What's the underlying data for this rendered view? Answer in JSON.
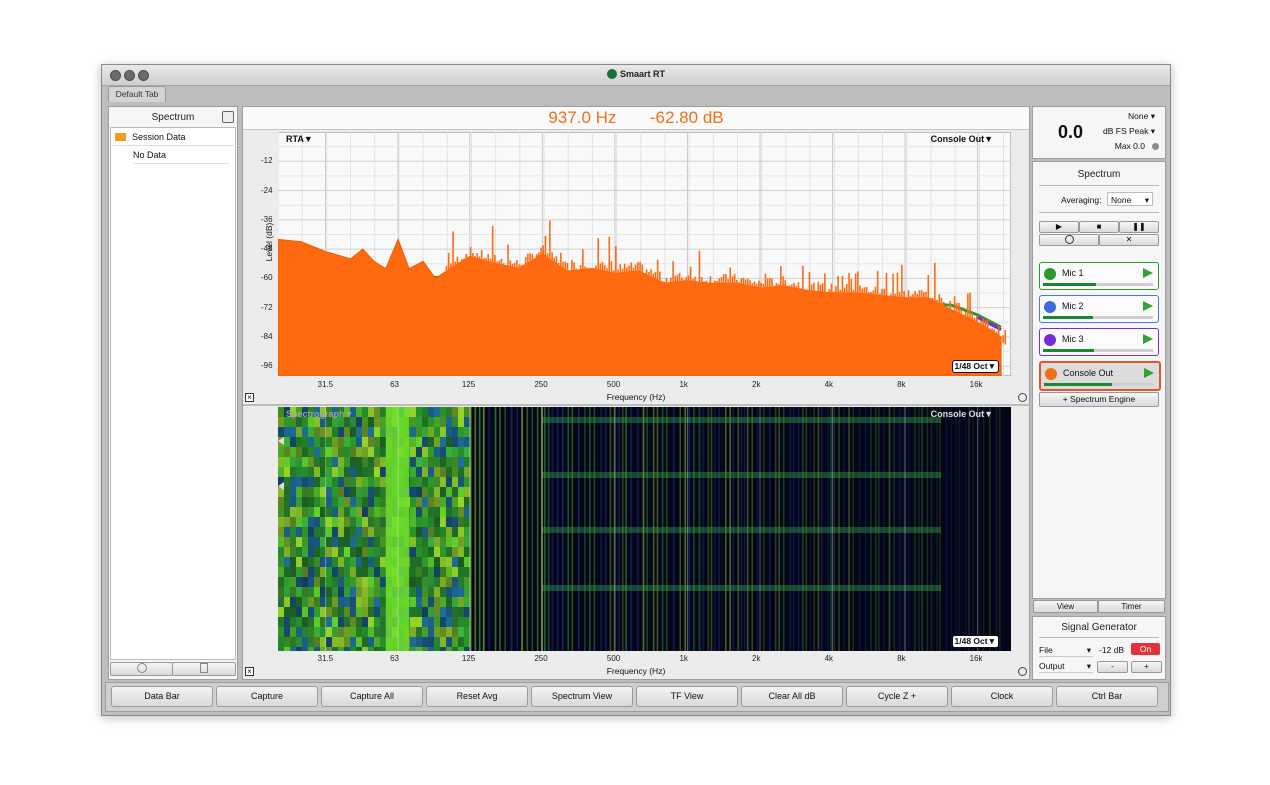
{
  "window": {
    "title": "Smaart RT",
    "tab": "Default Tab"
  },
  "left_panel": {
    "title": "Spectrum",
    "items": [
      {
        "label": "Session Data"
      },
      {
        "label": "No Data"
      }
    ]
  },
  "readout": {
    "frequency": "937.0 Hz",
    "level": "-62.80 dB"
  },
  "rta": {
    "mode_label": "RTA▼",
    "source_label": "Console Out▼",
    "resolution": "1/48 Oct▼",
    "y_axis_label": "Level (dB)",
    "x_axis_label": "Frequency (Hz)",
    "y_ticks": [
      "-12",
      "-24",
      "-36",
      "-48",
      "-60",
      "-72",
      "-84",
      "-96"
    ],
    "x_ticks": [
      "31.5",
      "63",
      "125",
      "250",
      "500",
      "1k",
      "2k",
      "4k",
      "8k",
      "16k"
    ]
  },
  "spectrograph": {
    "mode_label": "Spectrograph▼",
    "source_label": "Console Out▼",
    "resolution": "1/48 Oct▼",
    "x_axis_label": "Frequency (Hz)",
    "x_ticks": [
      "31.5",
      "63",
      "125",
      "250",
      "500",
      "1k",
      "2k",
      "4k",
      "8k",
      "16k"
    ]
  },
  "chart_data": {
    "type": "area",
    "title": "",
    "xlabel": "Frequency (Hz)",
    "ylabel": "Level (dB)",
    "x_scale": "log",
    "xlim": [
      20,
      22000
    ],
    "ylim": [
      -100,
      0
    ],
    "grid": true,
    "series": [
      {
        "name": "Console Out",
        "color": "#ff6a10",
        "x": [
          20,
          25,
          31.5,
          40,
          45,
          50,
          56,
          63,
          70,
          80,
          90,
          100,
          125,
          160,
          200,
          250,
          315,
          400,
          500,
          630,
          800,
          1000,
          1250,
          1600,
          2000,
          2500,
          3150,
          4000,
          5000,
          6300,
          8000,
          10000,
          12500,
          16000,
          20000
        ],
        "y": [
          -44,
          -45,
          -49,
          -52,
          -48,
          -53,
          -56,
          -44,
          -56,
          -53,
          -60,
          -57,
          -51,
          -54,
          -56,
          -50,
          -57,
          -56,
          -58,
          -57,
          -62,
          -61,
          -62,
          -62,
          -64,
          -63,
          -65,
          -66,
          -66,
          -67,
          -68,
          -68,
          -73,
          -78,
          -84
        ]
      },
      {
        "name": "Mic 1",
        "color": "#2a9a2a",
        "x": [
          45,
          12500,
          16000,
          20000
        ],
        "y": [
          -58,
          -71,
          -75,
          -80
        ]
      },
      {
        "name": "Mic 3",
        "color": "#7a2ad6",
        "x": [
          16000,
          20000
        ],
        "y": [
          -76,
          -81
        ]
      }
    ]
  },
  "meter": {
    "value": "0.0",
    "source": "None",
    "mode": "dB FS Peak",
    "max": "Max 0.0"
  },
  "right_panel": {
    "title": "Spectrum",
    "averaging_label": "Averaging:",
    "averaging_value": "None",
    "measurements": [
      {
        "label": "Mic 1",
        "color": "#2a9a2a",
        "border": "#2a9a2a",
        "level": 0.48
      },
      {
        "label": "Mic 2",
        "color": "#3c6be0",
        "border": "#4a78e6",
        "level": 0.45
      },
      {
        "label": "Mic 3",
        "color": "#7a2ad6",
        "border": "#7a2ad6",
        "level": 0.46
      },
      {
        "label": "Console Out",
        "color": "#f0701a",
        "border": "#e0582a",
        "level": 0.62
      }
    ],
    "add_engine": "+ Spectrum Engine",
    "view_tab": "View",
    "timer_tab": "Timer"
  },
  "signal_generator": {
    "title": "Signal Generator",
    "source": "File",
    "level": "-12 dB",
    "on_label": "On",
    "output": "Output",
    "minus": "-",
    "plus": "+"
  },
  "toolbar": [
    "Data Bar",
    "Capture",
    "Capture All",
    "Reset Avg",
    "Spectrum View",
    "TF View",
    "Clear All dB",
    "Cycle Z +",
    "Clock",
    "Ctrl Bar"
  ]
}
